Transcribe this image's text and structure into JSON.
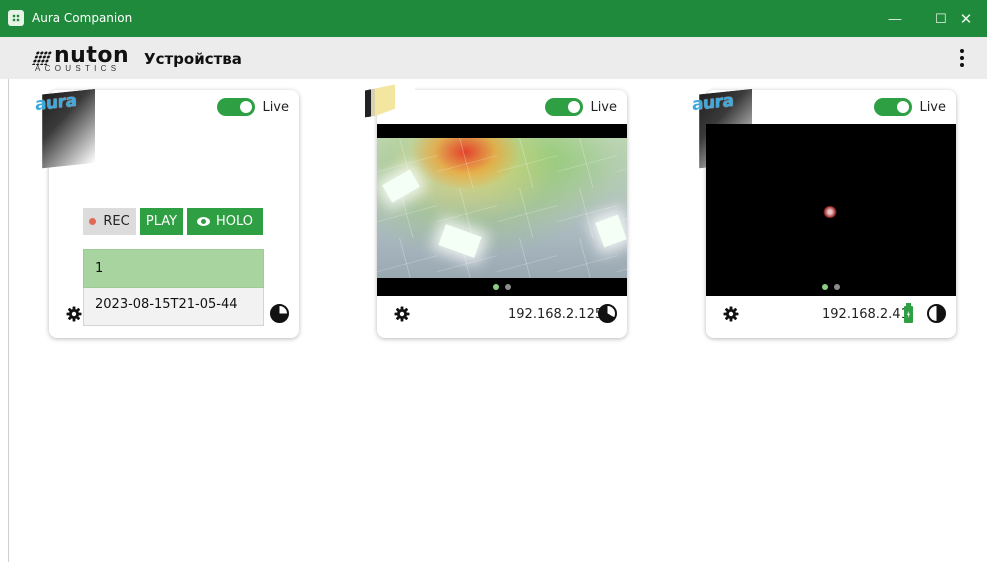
{
  "window": {
    "title": "Aura Companion",
    "controls": {
      "minimize": "—",
      "maximize": "☐",
      "close": "✕"
    }
  },
  "header": {
    "logo_word": "nuton",
    "logo_sub": "ACOUSTICS",
    "page_title": "Устройства",
    "menu_icon": "kebab-menu-icon"
  },
  "colors": {
    "accent": "#2ea043",
    "titlebar": "#1f8a3c",
    "aura_blue": "#3da9dd",
    "selected_row": "#a8d59f"
  },
  "devices": [
    {
      "badge": "aura",
      "live_label": "Live",
      "live_on": true,
      "controls": {
        "rec": "REC",
        "play": "PLAY",
        "holo": "HOLO"
      },
      "recordings": [
        "1",
        "2023-08-15T21-05-44"
      ],
      "selected_recording": 0,
      "pie_icon": "pie-three-quarter-icon"
    },
    {
      "badge": "",
      "live_label": "Live",
      "live_on": true,
      "ip": "192.168.2.125",
      "page_dots": 2,
      "active_dot": 0,
      "pie_icon": "pie-one-third-icon"
    },
    {
      "badge": "aura",
      "live_label": "Live",
      "live_on": true,
      "ip": "192.168.2.41",
      "page_dots": 2,
      "active_dot": 0,
      "battery_icon": "battery-charging-icon",
      "pie_icon": "pie-half-icon"
    }
  ]
}
